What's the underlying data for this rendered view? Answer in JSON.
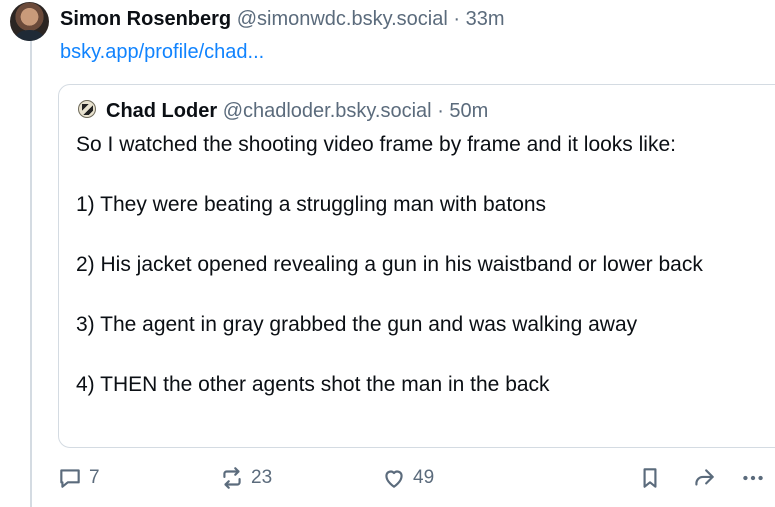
{
  "post": {
    "author_name": "Simon Rosenberg",
    "author_handle": "@simonwdc.bsky.social",
    "separator": "·",
    "time": "33m",
    "link_text": "bsky.app/profile/chad..."
  },
  "quote": {
    "author_name": "Chad Loder",
    "author_handle": "@chadloder.bsky.social",
    "separator": "·",
    "time": "50m",
    "lines": [
      "So I watched the shooting video frame by frame and it looks like:",
      "1) They were beating a struggling man with batons",
      "2) His jacket opened revealing a gun in his waistband or lower back",
      "3) The agent in gray grabbed the gun and was walking away",
      "4) THEN the other agents shot the man in the back"
    ]
  },
  "actions": {
    "reply_count": "7",
    "repost_count": "23",
    "like_count": "49",
    "icons": [
      "reply-icon",
      "repost-icon",
      "like-icon",
      "bookmark-icon",
      "share-icon",
      "more-icon"
    ]
  },
  "colors": {
    "link": "#1083fe",
    "muted": "#5b6b7c",
    "border": "#d4dbe2"
  }
}
